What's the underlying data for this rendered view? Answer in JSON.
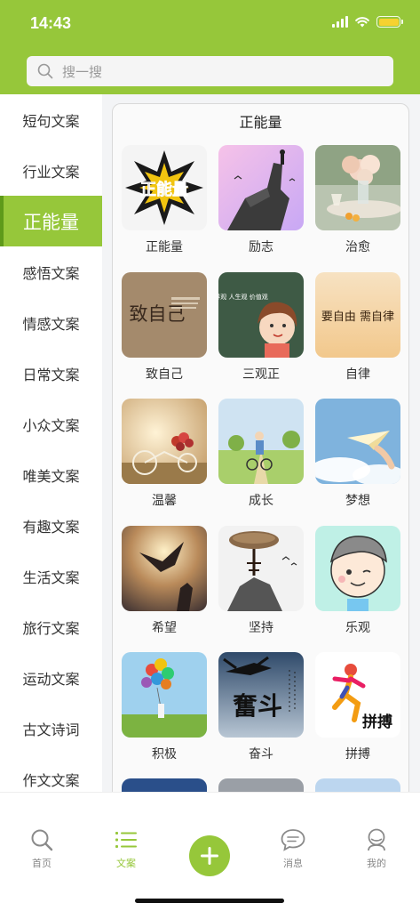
{
  "status_bar": {
    "time": "14:43"
  },
  "search": {
    "placeholder": "搜一搜"
  },
  "sidebar": {
    "items": [
      {
        "label": "短句文案"
      },
      {
        "label": "行业文案"
      },
      {
        "label": "正能量",
        "active": true
      },
      {
        "label": "感悟文案"
      },
      {
        "label": "情感文案"
      },
      {
        "label": "日常文案"
      },
      {
        "label": "小众文案"
      },
      {
        "label": "唯美文案"
      },
      {
        "label": "有趣文案"
      },
      {
        "label": "生活文案"
      },
      {
        "label": "旅行文案"
      },
      {
        "label": "运动文案"
      },
      {
        "label": "古文诗词"
      },
      {
        "label": "作文文案"
      }
    ]
  },
  "panel": {
    "title": "正能量",
    "categories": [
      {
        "label": "正能量",
        "thumb_text": "正能量"
      },
      {
        "label": "励志"
      },
      {
        "label": "治愈"
      },
      {
        "label": "致自己",
        "thumb_text": "致自己"
      },
      {
        "label": "三观正",
        "thumb_text": "世界观 人生观 价值观"
      },
      {
        "label": "自律",
        "thumb_text": "要自由 需自律"
      },
      {
        "label": "温馨"
      },
      {
        "label": "成长"
      },
      {
        "label": "梦想"
      },
      {
        "label": "希望"
      },
      {
        "label": "坚持"
      },
      {
        "label": "乐观"
      },
      {
        "label": "积极"
      },
      {
        "label": "奋斗",
        "thumb_text": "奮斗"
      },
      {
        "label": "拼搏",
        "thumb_text": "拼搏"
      }
    ]
  },
  "tabbar": {
    "tabs": [
      {
        "label": "首页",
        "icon": "search-icon"
      },
      {
        "label": "文案",
        "icon": "list-icon",
        "active": true
      },
      {
        "label": "",
        "icon": "add-icon"
      },
      {
        "label": "消息",
        "icon": "chat-icon"
      },
      {
        "label": "我的",
        "icon": "user-icon"
      }
    ]
  },
  "colors": {
    "accent": "#96c73a",
    "background": "#f3f4f6"
  }
}
